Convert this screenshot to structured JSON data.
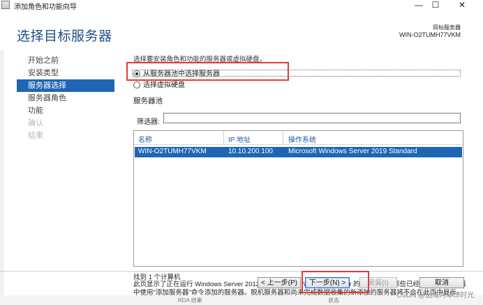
{
  "window": {
    "title": "添加角色和功能向导",
    "minimize": "—",
    "maximize": "☐",
    "close": "✕"
  },
  "header": {
    "page_title": "选择目标服务器",
    "dest_label": "目标服务器",
    "dest_server": "WIN-O2TUMH77VKM"
  },
  "sidebar": {
    "items": [
      {
        "label": "开始之前",
        "state": "normal"
      },
      {
        "label": "安装类型",
        "state": "normal"
      },
      {
        "label": "服务器选择",
        "state": "active"
      },
      {
        "label": "服务器角色",
        "state": "normal"
      },
      {
        "label": "功能",
        "state": "normal"
      },
      {
        "label": "确认",
        "state": "disabled"
      },
      {
        "label": "结果",
        "state": "disabled"
      }
    ]
  },
  "main": {
    "intro": "选择要安装角色和功能的服务器或虚拟硬盘。",
    "radio_pool": "从服务器池中选择服务器",
    "radio_vhd": "选择虚拟硬盘",
    "pool_title": "服务器池",
    "filter_label": "筛选器:",
    "filter_value": "",
    "columns": [
      "名称",
      "IP 地址",
      "操作系统"
    ],
    "rows": [
      {
        "name": "WIN-O2TUMH77VKM",
        "ip": "10.10.200.100",
        "os": "Microsoft Windows Server 2019 Standard"
      }
    ],
    "found": "找到 1 个计算机",
    "description": "此页显示了正在运行 Windows Server 2012 或更新版本的 Windows Server 的服务器以及那些已经在服务器管理器中使用\"添加服务器\"命令添加的服务器。脱机服务器和尚未完成数据收集的新添加的服务器将不会在此页中显示。"
  },
  "buttons": {
    "prev": "< 上一步(P)",
    "next": "下一步(N) >",
    "install": "安装(I)",
    "cancel": "取消"
  },
  "overlay": {
    "watermark": "CSDN @运维阿草印时光",
    "bottom_left": "RDA 结果",
    "bottom_right": "状态"
  },
  "colors": {
    "accent": "#1e66b4",
    "title_blue": "#1c4f89",
    "highlight_red": "#e23a3a"
  }
}
